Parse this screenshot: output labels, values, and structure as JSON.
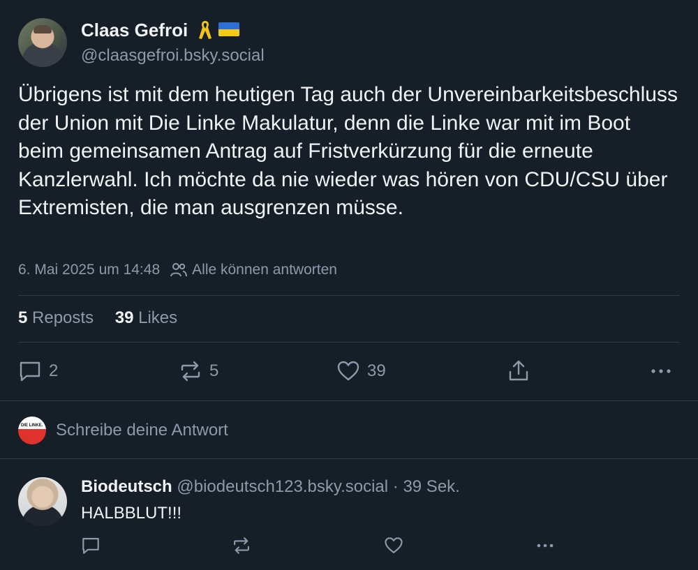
{
  "post": {
    "author": {
      "display_name": "Claas Gefroi",
      "handle": "@claasgefroi.bsky.social",
      "name_icons": [
        "yellow-ribbon-icon",
        "ukraine-flag-icon"
      ]
    },
    "text": "Übrigens ist mit dem heutigen Tag auch der Unvereinbarkeitsbeschluss der Union mit Die Linke Makulatur, denn die Linke war mit im Boot beim gemeinsamen Antrag auf Fristverkürzung für die erneute Kanzlerwahl. Ich möchte da nie wieder was hören von CDU/CSU über Extremisten, die man ausgrenzen müsse.",
    "timestamp": "6. Mai 2025 um 14:48",
    "reply_permission": "Alle können antworten",
    "stats": {
      "reposts_count": "5",
      "reposts_label": "Reposts",
      "likes_count": "39",
      "likes_label": "Likes"
    },
    "actions": {
      "reply_count": "2",
      "repost_count": "5",
      "like_count": "39"
    }
  },
  "composer": {
    "placeholder": "Schreibe deine Antwort"
  },
  "reply": {
    "display_name": "Biodeutsch",
    "handle_time": "@biodeutsch123.bsky.social · 39 Sek.",
    "text": "HALBBLUT!!!"
  },
  "colors": {
    "background": "#161e27",
    "text": "#f1f3f5",
    "muted": "#8c9aab",
    "divider": "#2e3a48"
  }
}
